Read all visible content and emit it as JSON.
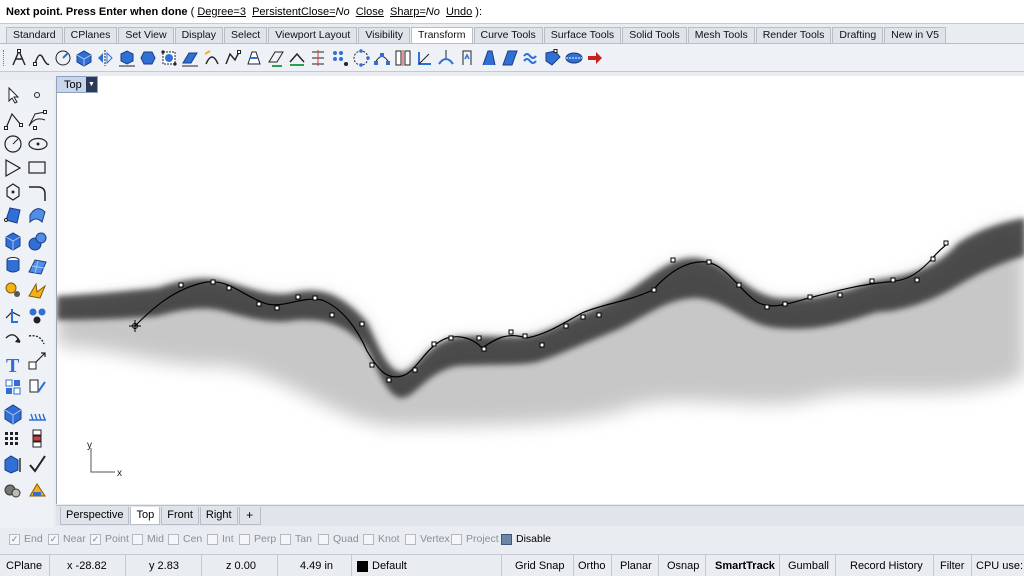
{
  "command": {
    "prompt": "Next point. Press Enter when done",
    "open_paren": " ( ",
    "degree_label": "Degree=3",
    "persistent_close_label": "PersistentClose=",
    "persistent_close_value": "No",
    "close_label": "Close",
    "sharp_label": "Sharp=",
    "sharp_value": "No",
    "undo_label": "Undo",
    "close_paren": " ):"
  },
  "toolbar_tabs": [
    {
      "label": "Standard",
      "active": false
    },
    {
      "label": "CPlanes",
      "active": false
    },
    {
      "label": "Set View",
      "active": false
    },
    {
      "label": "Display",
      "active": false
    },
    {
      "label": "Select",
      "active": false
    },
    {
      "label": "Viewport Layout",
      "active": false
    },
    {
      "label": "Visibility",
      "active": false
    },
    {
      "label": "Transform",
      "active": true
    },
    {
      "label": "Curve Tools",
      "active": false
    },
    {
      "label": "Surface Tools",
      "active": false
    },
    {
      "label": "Solid Tools",
      "active": false
    },
    {
      "label": "Mesh Tools",
      "active": false
    },
    {
      "label": "Render Tools",
      "active": false
    },
    {
      "label": "Drafting",
      "active": false
    },
    {
      "label": "New in V5",
      "active": false
    }
  ],
  "transform_icons": [
    "move-icon",
    "copy-icon",
    "rotate-icon",
    "rotate-3d-icon",
    "mirror-icon",
    "scale-icon",
    "scale-1d-icon",
    "scale-2d-icon",
    "shear-icon",
    "twist-icon",
    "bend-icon",
    "taper-icon",
    "flow-icon",
    "smash-icon",
    "orient-icon",
    "array-icon",
    "array-polar-icon",
    "array-curve-icon",
    "align-icon",
    "set-points-icon",
    "project-icon",
    "pull-icon",
    "splop-icon",
    "stretch-icon",
    "cage-edit-icon",
    "flow-surface-icon",
    "maelstrom-icon",
    "arrow-right-icon"
  ],
  "viewport": {
    "name": "Top",
    "axis_x": "x",
    "axis_y": "y"
  },
  "viewport_tabs": [
    {
      "label": "Perspective",
      "active": false
    },
    {
      "label": "Top",
      "active": true
    },
    {
      "label": "Front",
      "active": false
    },
    {
      "label": "Right",
      "active": false
    }
  ],
  "viewport_add": "+",
  "osnaps": [
    {
      "label": "End",
      "checked": true
    },
    {
      "label": "Near",
      "checked": true
    },
    {
      "label": "Point",
      "checked": true
    },
    {
      "label": "Mid",
      "checked": false
    },
    {
      "label": "Cen",
      "checked": false
    },
    {
      "label": "Int",
      "checked": false
    },
    {
      "label": "Perp",
      "checked": false
    },
    {
      "label": "Tan",
      "checked": false
    },
    {
      "label": "Quad",
      "checked": false
    },
    {
      "label": "Knot",
      "checked": false
    },
    {
      "label": "Vertex",
      "checked": false
    },
    {
      "label": "Project",
      "checked": false
    },
    {
      "label": "Disable",
      "checked": false
    }
  ],
  "status": {
    "cplane": "CPlane",
    "x": "x -28.82",
    "y": "y 2.83",
    "z": "z 0.00",
    "distance": "4.49 in",
    "layer": "Default",
    "buttons": [
      "Grid Snap",
      "Ortho",
      "Planar",
      "Osnap",
      "SmartTrack",
      "Gumball",
      "Record History",
      "Filter",
      "CPU use:"
    ],
    "active_button": "SmartTrack"
  },
  "colors": {
    "accent": "#2d3a55",
    "curve": "#000000",
    "viewport_bg": "#ffffff",
    "terrain_shade": "#404040"
  }
}
